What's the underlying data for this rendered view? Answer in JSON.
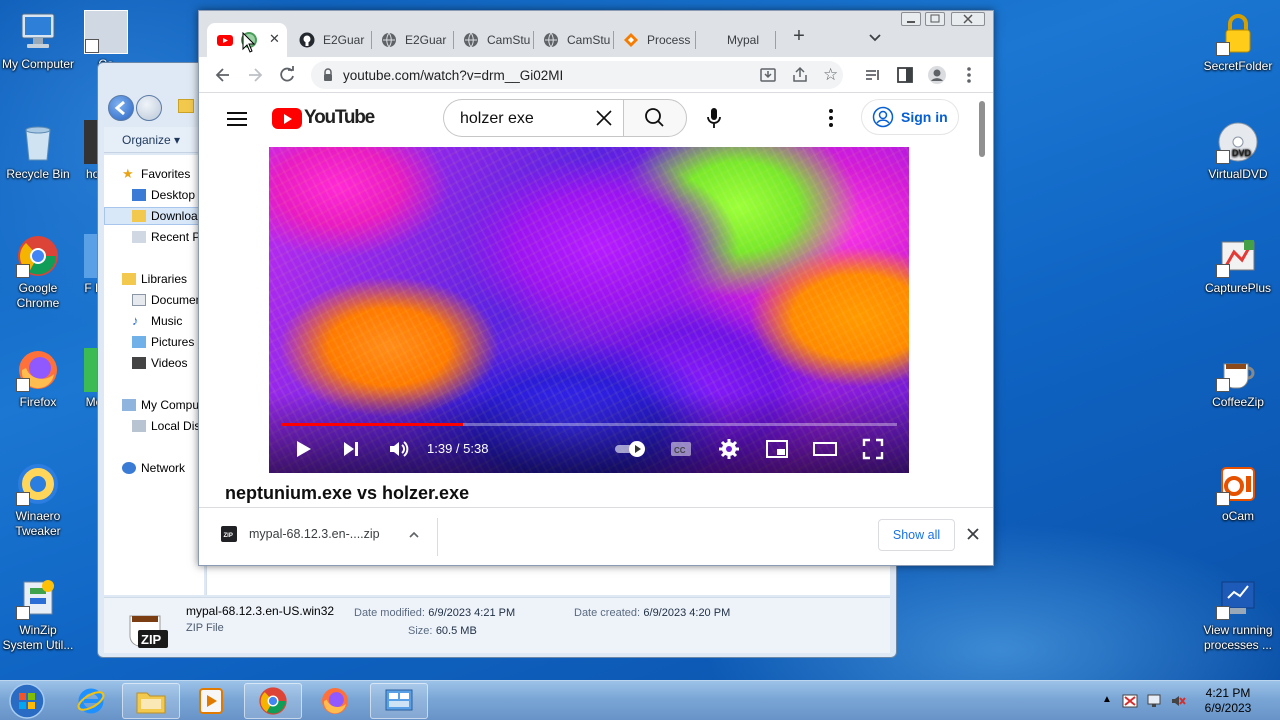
{
  "desktop": {
    "left_icons": [
      {
        "label": "My Computer",
        "icon": "computer-icon"
      },
      {
        "label": "Recycle Bin",
        "icon": "recycle-bin-icon"
      },
      {
        "label": "Google Chrome",
        "icon": "chrome-icon"
      },
      {
        "label": "Firefox",
        "icon": "firefox-icon"
      },
      {
        "label": "Winaero Tweaker",
        "icon": "winaero-icon"
      },
      {
        "label": "WinZip System Util...",
        "icon": "winzip-icon"
      }
    ],
    "second_col_labels": [
      "Ca",
      "hol",
      "F H",
      "Me"
    ],
    "right_icons": [
      {
        "label": "SecretFolder",
        "icon": "lock-folder-icon"
      },
      {
        "label": "VirtualDVD",
        "icon": "dvd-icon"
      },
      {
        "label": "CapturePlus",
        "icon": "captureplus-icon"
      },
      {
        "label": "CoffeeZip",
        "icon": "coffeezip-icon"
      },
      {
        "label": "oCam",
        "icon": "ocam-icon"
      },
      {
        "label": "View running processes ...",
        "icon": "process-viewer-icon"
      }
    ]
  },
  "explorer": {
    "organize_label": "Organize",
    "sidebar": {
      "favorites": "Favorites",
      "favorites_items": [
        "Desktop",
        "Downloads",
        "Recent Places"
      ],
      "libraries": "Libraries",
      "libraries_items": [
        "Documents",
        "Music",
        "Pictures",
        "Videos"
      ],
      "computer": "My Computer",
      "computer_items": [
        "Local Disk"
      ],
      "network": "Network"
    },
    "details": {
      "name": "mypal-68.12.3.en-US.win32",
      "type": "ZIP File",
      "date_modified_label": "Date modified:",
      "date_modified": "6/9/2023 4:21 PM",
      "date_created_label": "Date created:",
      "date_created": "6/9/2023 4:20 PM",
      "size_label": "Size:",
      "size": "60.5 MB",
      "zip_badge": "ZIP"
    }
  },
  "chrome": {
    "tabs": [
      {
        "title": "",
        "favicon": "youtube-icon",
        "active": true
      },
      {
        "title": "E2Guar",
        "favicon": "github-icon"
      },
      {
        "title": "E2Guar",
        "favicon": "globe-icon"
      },
      {
        "title": "CamStu",
        "favicon": "globe-icon"
      },
      {
        "title": "CamStu",
        "favicon": "globe-icon"
      },
      {
        "title": "Process",
        "favicon": "process-icon"
      },
      {
        "title": "Mypal",
        "favicon": "none"
      }
    ],
    "new_tab_label": "+",
    "url": "youtube.com/watch?v=drm__Gi02MI"
  },
  "youtube": {
    "logo_text": "YouTube",
    "search_value": "holzer exe",
    "sign_in": "Sign in",
    "video": {
      "time": "1:39 / 5:38",
      "progress_fraction": 0.295,
      "title": "neptunium.exe vs holzer.exe"
    }
  },
  "downloads": {
    "file": "mypal-68.12.3.en-....zip",
    "show_all": "Show all"
  },
  "taskbar": {
    "time": "4:21 PM",
    "date": "6/9/2023"
  },
  "colors": {
    "youtube_red": "#ff0000",
    "link_blue": "#065fd4",
    "chrome_blue": "#1a73e8"
  }
}
